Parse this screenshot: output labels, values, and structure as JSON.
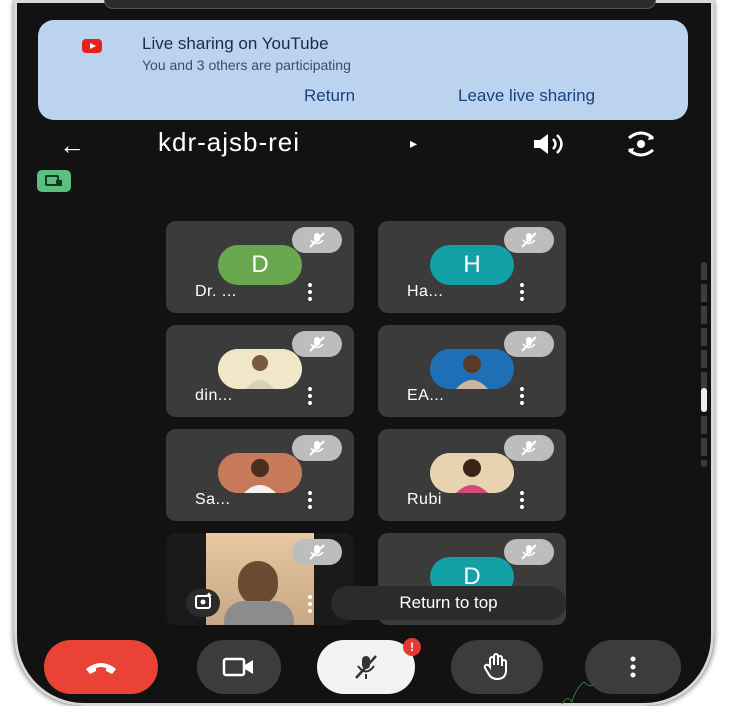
{
  "banner": {
    "icon": "youtube-icon",
    "title": "Live sharing on YouTube",
    "subtitle": "You and 3 others are participating",
    "return_label": "Return",
    "leave_label": "Leave live sharing"
  },
  "header": {
    "meeting_code": "kdr-ajsb-rei",
    "caret": "▸",
    "back_icon": "back-arrow-icon",
    "speaker_icon": "speaker-icon",
    "switch_camera_icon": "switch-camera-icon",
    "cast_icon": "cast-icon"
  },
  "participants": [
    {
      "name": "Dr. ...",
      "avatar_letter": "D",
      "avatar_color": "#6aa84f",
      "muted": true
    },
    {
      "name": "Ha...",
      "avatar_letter": "H",
      "avatar_color": "#12a1a6",
      "muted": true
    },
    {
      "name": "din...",
      "avatar_letter": "",
      "muted": true
    },
    {
      "name": "EA...",
      "avatar_letter": "",
      "muted": true
    },
    {
      "name": "Sa...",
      "avatar_letter": "",
      "muted": true
    },
    {
      "name": "Rubi",
      "avatar_letter": "",
      "muted": true
    },
    {
      "name": "",
      "avatar_letter": "",
      "muted": true,
      "video": true
    },
    {
      "name": "",
      "avatar_letter": "D",
      "avatar_color": "#12a1a6",
      "muted": true
    }
  ],
  "return_to_top_label": "Return to top",
  "controls": {
    "end_call_icon": "end-call-icon",
    "camera_icon": "camera-icon",
    "mic_icon": "mic-off-icon",
    "mic_badge": "!",
    "raise_hand_icon": "raise-hand-icon",
    "more_icon": "more-vert-icon"
  },
  "colors": {
    "banner_bg": "#bcd3f0",
    "end_call": "#ea4335",
    "tile_bg": "#3b3b3b",
    "background": "#121212"
  }
}
